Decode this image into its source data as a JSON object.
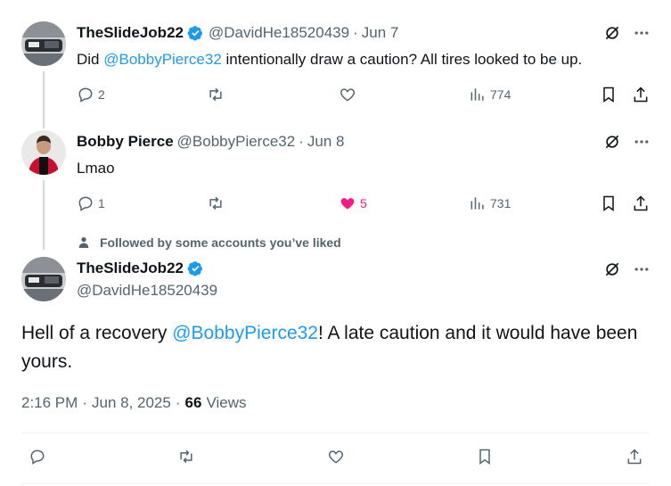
{
  "tweet1": {
    "name": "TheSlideJob22",
    "handle": "@DavidHe18520439",
    "sep": "·",
    "date": "Jun 7",
    "text_before": "Did ",
    "mention": "@BobbyPierce32",
    "text_after": " intentionally draw a caution? All tires looked to be up.",
    "replies": "2",
    "likes": "",
    "views": "774"
  },
  "tweet2": {
    "name": "Bobby Pierce",
    "handle": "@BobbyPierce32",
    "sep": "·",
    "date": "Jun 8",
    "text": "Lmao",
    "replies": "1",
    "likes": "5",
    "views": "731"
  },
  "context": {
    "label": "Followed by some accounts you’ve liked"
  },
  "main": {
    "name": "TheSlideJob22",
    "handle": "@DavidHe18520439",
    "text_before": "Hell of a recovery ",
    "mention": "@BobbyPierce32",
    "text_after": "! A late caution and it would have been yours.",
    "time": "2:16 PM",
    "sep": "·",
    "date": "Jun 8, 2025",
    "views_count": "66",
    "views_label": "Views"
  },
  "colors": {
    "accent": "#1d9bf0",
    "like": "#f91880",
    "muted": "#536471"
  }
}
